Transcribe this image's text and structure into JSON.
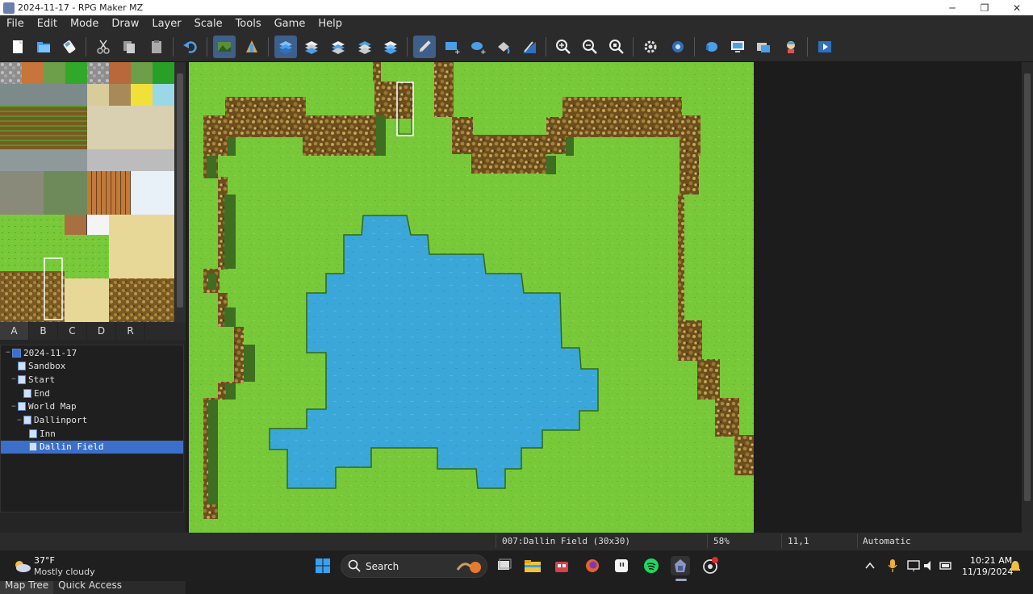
{
  "window": {
    "title": "2024-11-17 - RPG Maker MZ",
    "controls": [
      "─",
      "❐",
      "✕"
    ]
  },
  "menu": [
    "File",
    "Edit",
    "Mode",
    "Draw",
    "Layer",
    "Scale",
    "Tools",
    "Game",
    "Help"
  ],
  "toolbar": {
    "icons": [
      "new-project-icon",
      "open-project-icon",
      "save-project-icon",
      "cut-icon",
      "copy-icon",
      "paste-icon",
      "undo-icon",
      "map-mode-icon",
      "event-mode-icon",
      "layer-auto-icon",
      "layer-1-icon",
      "layer-2-icon",
      "layer-3-icon",
      "layer-4-icon",
      "pencil-icon",
      "rectangle-icon",
      "ellipse-icon",
      "fill-icon",
      "shadow-pen-icon",
      "zoom-in-icon",
      "zoom-out-icon",
      "zoom-actual-icon",
      "database-icon",
      "plugin-manager-icon",
      "sound-test-icon",
      "event-searcher-icon",
      "resource-manager-icon",
      "character-generator-icon",
      "playtest-icon"
    ]
  },
  "tileset_tabs": [
    "A",
    "B",
    "C",
    "D",
    "R"
  ],
  "map_tree": [
    {
      "label": "2024-11-17",
      "level": 0,
      "toggle": "−",
      "root": true
    },
    {
      "label": "Sandbox",
      "level": 1,
      "toggle": ""
    },
    {
      "label": "Start",
      "level": 1,
      "toggle": "−"
    },
    {
      "label": "End",
      "level": 2,
      "toggle": ""
    },
    {
      "label": "World Map",
      "level": 1,
      "toggle": "−"
    },
    {
      "label": "Dallinport",
      "level": 2,
      "toggle": "−"
    },
    {
      "label": "Inn",
      "level": 3,
      "toggle": ""
    },
    {
      "label": "Dallin Field",
      "level": 3,
      "toggle": "",
      "selected": true
    }
  ],
  "bottom_tabs": [
    "Map Tree",
    "Quick Access"
  ],
  "status": {
    "map": "007:Dallin Field (30x30)",
    "zoom": "58%",
    "coords": "11,1",
    "mode": "Automatic"
  },
  "taskbar": {
    "weather_temp": "37°F",
    "weather_desc": "Mostly cloudy",
    "search_label": "Search",
    "time": "10:21 AM",
    "date": "11/19/2024"
  },
  "colors": {
    "grass": "#78c93a",
    "water": "#3aa7d8",
    "cliff": "#8a6a2c",
    "accent": "#3b6fc9"
  }
}
